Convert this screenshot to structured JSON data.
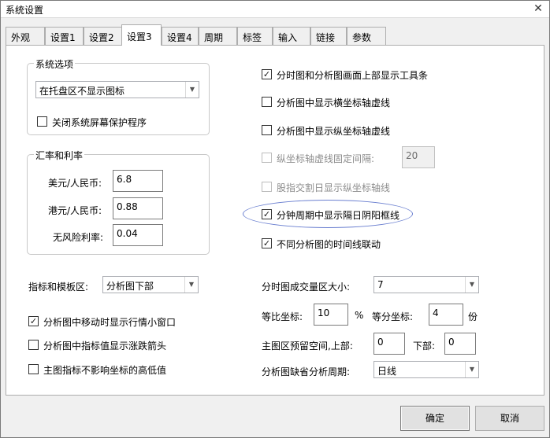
{
  "window": {
    "title": "系统设置",
    "close_glyph": "✕"
  },
  "tabs": [
    {
      "label": "外观"
    },
    {
      "label": "设置1"
    },
    {
      "label": "设置2"
    },
    {
      "label": "设置3"
    },
    {
      "label": "设置4"
    },
    {
      "label": "周期"
    },
    {
      "label": "标签"
    },
    {
      "label": "输入"
    },
    {
      "label": "链接"
    },
    {
      "label": "参数"
    }
  ],
  "active_tab": "设置3",
  "system_options": {
    "label": "系统选项",
    "tray_combo": "在托盘区不显示图标",
    "close_screensaver": {
      "label": "关闭系统屏幕保护程序",
      "checked": false
    }
  },
  "exchange": {
    "label": "汇率和利率",
    "usd_label": "美元/人民币:",
    "usd_value": "6.8",
    "hkd_label": "港元/人民币:",
    "hkd_value": "0.88",
    "rf_label": "无风险利率:",
    "rf_value": "0.04"
  },
  "indicator": {
    "label": "指标和模板区:",
    "value": "分析图下部"
  },
  "left_checks": [
    {
      "label": "分析图中移动时显示行情小窗口",
      "checked": true
    },
    {
      "label": "分析图中指标值显示涨跌箭头",
      "checked": false
    },
    {
      "label": "主图指标不影响坐标的高低值",
      "checked": false
    }
  ],
  "right_checks": [
    {
      "label": "分时图和分析图画面上部显示工具条",
      "checked": true
    },
    {
      "label": "分析图中显示横坐标轴虚线",
      "checked": false
    },
    {
      "label": "分析图中显示纵坐标轴虚线",
      "checked": false
    },
    {
      "label": "纵坐标轴虚线固定间隔:",
      "checked": false,
      "disabled": true
    },
    {
      "label": "股指交割日显示纵坐标轴线",
      "checked": false,
      "disabled": true
    },
    {
      "label": "分钟周期中显示隔日阴阳框线",
      "checked": true
    },
    {
      "label": "不同分析图的时间线联动",
      "checked": true
    }
  ],
  "fixed_interval_value": "20",
  "volume_area": {
    "label": "分时图成交量区大小:",
    "value": "7"
  },
  "coords": {
    "ratio_label": "等比坐标:",
    "ratio_value": "10",
    "ratio_unit": "%",
    "equal_label": "等分坐标:",
    "equal_value": "4",
    "equal_unit": "份"
  },
  "reserve": {
    "top_label": "主图区预留空间,上部:",
    "top_value": "0",
    "bottom_label": "下部:",
    "bottom_value": "0"
  },
  "default_period": {
    "label": "分析图缺省分析周期:",
    "value": "日线"
  },
  "buttons": {
    "ok": "确定",
    "cancel": "取消"
  },
  "check_glyph": "✓",
  "arrow_glyph": "▼",
  "colors": {
    "highlight_ellipse": "#6a7fd0"
  }
}
